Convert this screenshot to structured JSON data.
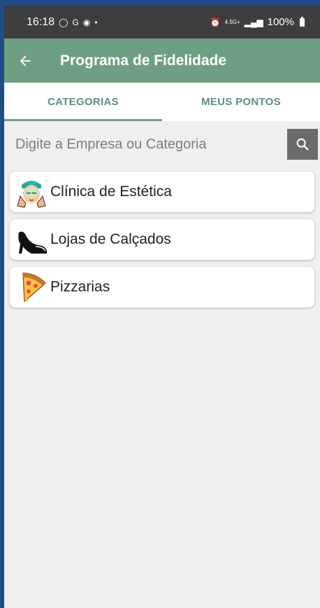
{
  "status_bar": {
    "time": "16:18",
    "network": "4.5G+",
    "battery": "100%"
  },
  "app_bar": {
    "title": "Programa de Fidelidade",
    "back_icon": "arrow-left-icon",
    "color": "#6f9f82"
  },
  "tabs": [
    {
      "label": "CATEGORIAS",
      "active": true
    },
    {
      "label": "MEUS PONTOS",
      "active": false
    }
  ],
  "search": {
    "placeholder": "Digite a Empresa ou Categoria",
    "value": "",
    "button_icon": "search-icon"
  },
  "categories": [
    {
      "label": "Clínica de Estética",
      "icon": "face-mask-icon"
    },
    {
      "label": "Lojas de Calçados",
      "icon": "high-heel-shoe-icon"
    },
    {
      "label": "Pizzarias",
      "icon": "pizza-slice-icon"
    }
  ]
}
